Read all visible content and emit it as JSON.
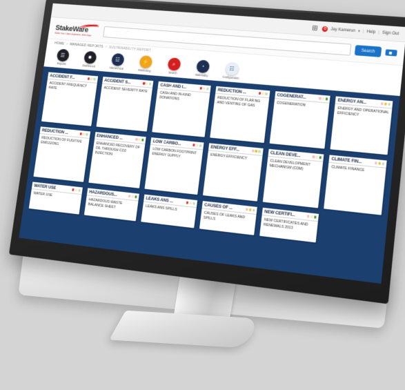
{
  "topbar": {
    "grid_icon": "grid-icon",
    "user_badge": "O",
    "user_name": "Jay Kamerun",
    "caret": "▾",
    "sep": "|",
    "help_label": "Help",
    "signout_label": "Sign Out"
  },
  "brand": {
    "name_stake": "Stake",
    "name_ware": "Ware",
    "tagline": "Stake Your Claim Anywhere, With Ease."
  },
  "search": {
    "value": "",
    "placeholder": "",
    "button_label": "Search",
    "flag_button": "flag-button"
  },
  "breadcrumb": {
    "items": [
      "HOME",
      "MANAGED REPORTS",
      "SUSTAINABILITY REPORT"
    ],
    "separator": ">"
  },
  "nav": {
    "items": [
      {
        "label": "Reports",
        "icon": "reports-icon",
        "glyph": "☰",
        "color": "#1f1f28"
      },
      {
        "label": "Dashboard",
        "icon": "dashboard-icon",
        "glyph": "✹",
        "color": "#1f1f28"
      },
      {
        "label": "Hierarchical",
        "icon": "hierarchical-icon",
        "glyph": "☳",
        "color": "#1d2f52"
      },
      {
        "label": "Monitoring",
        "icon": "monitoring-icon",
        "glyph": "⚡",
        "color": "#f0a41c"
      },
      {
        "label": "Search",
        "icon": "search-icon",
        "glyph": "⌕",
        "color": "#d51f1f"
      },
      {
        "label": "Materiality",
        "icon": "materiality-icon",
        "glyph": "◔",
        "color": "#1d2f52"
      },
      {
        "label": "Configuration",
        "icon": "configuration-icon",
        "glyph": "☷",
        "color": "#e8eef6"
      }
    ]
  },
  "colors": {
    "board_navy": "#1b4070",
    "accent_blue": "#1a73c8",
    "status_red": "#e03131",
    "status_yellow": "#e8c32e",
    "status_green": "#3f9b2f"
  },
  "board": {
    "rows": [
      {
        "cards": [
          {
            "title": "ACCIDENT F...",
            "body": "ACCIDENT FREQUENCY RATE",
            "status": "red"
          },
          {
            "title": "ACCIDENT S...",
            "body": "ACCIDENT SEVERITY RATE",
            "status": "red"
          },
          {
            "title": "CASH AND I...",
            "body": "CASH AND IN-KIND DONATIONS",
            "status": "red"
          },
          {
            "title": "REDUCTION ...",
            "body": "REDUCTION OF FLARING AND VENTING OF GAS",
            "status": "red"
          },
          {
            "title": "COGENERAT...",
            "body": "COGENERATION",
            "status": "green"
          },
          {
            "title": "ENERGY AN...",
            "body": "ENERGY AND OPERATIONAL EFFICIENCY",
            "status": "yellow"
          }
        ]
      },
      {
        "cards": [
          {
            "title": "REDUCTION ...",
            "body": "REDUCTION OF FUGITIVE EMISSIONS",
            "status": "red"
          },
          {
            "title": "ENHANCED ...",
            "body": "ENHANCED RECOVERY OF OIL THROUGH CO2 INJECTION",
            "status": "green"
          },
          {
            "title": "LOW CARBO...",
            "body": "LOW CARBON FOOTPRINT ENERGY SUPPLY",
            "status": "red"
          },
          {
            "title": "ENERGY EFF...",
            "body": "ENERGY EFFICIENCY",
            "status": "yellow"
          },
          {
            "title": "CLEAN DEVE...",
            "body": "CLEAN DEVELOPMENT MECHANISM (CDM)",
            "status": "green"
          },
          {
            "title": "CLIMATE FIN...",
            "body": "CLIMATE FINANCE",
            "status": "yellow"
          }
        ]
      },
      {
        "cards": [
          {
            "title": "WATER USE",
            "body": "WATER USE",
            "status": "red"
          },
          {
            "title": "HAZARDOUS...",
            "body": "HAZARDOUS WASTE BALANCE SHEET",
            "status": "green"
          },
          {
            "title": "LEAKS ANS ...",
            "body": "LEAKS ANS SPILLS",
            "status": "red"
          },
          {
            "title": "CAUSES OF ...",
            "body": "CAUSES OF LEAKS AND SPILLS",
            "status": "yellow"
          },
          {
            "title": "NEW CERTIFI...",
            "body": "NEW CERTIFICATES AND RENEWALS 2013",
            "status": "green"
          }
        ]
      }
    ]
  }
}
